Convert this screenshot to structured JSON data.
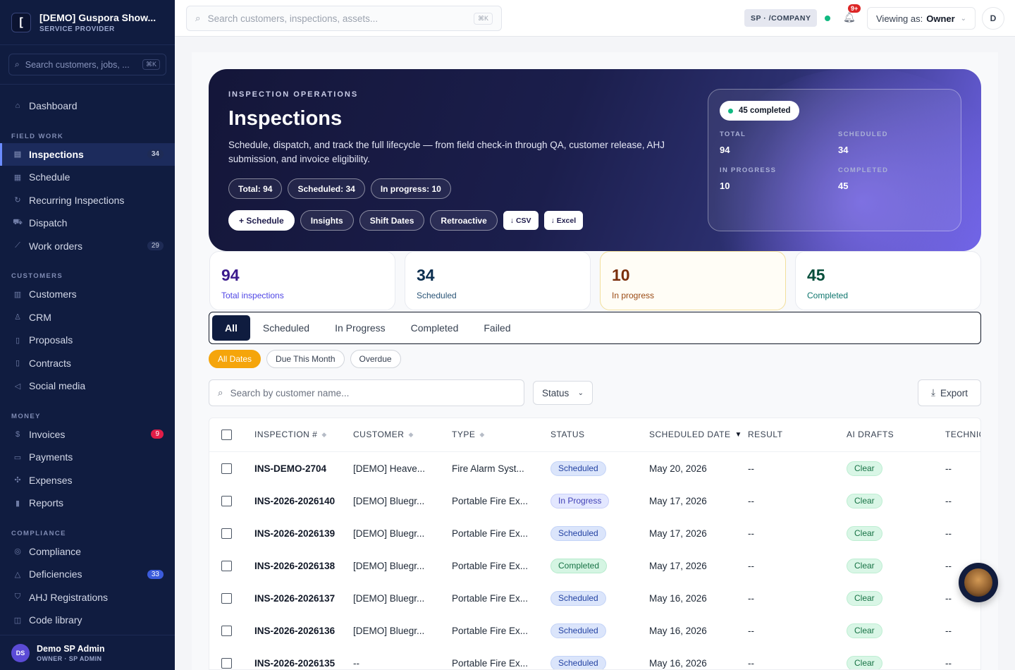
{
  "brand": {
    "logo": "[",
    "title": "[DEMO] Guspora Show...",
    "subtitle": "SERVICE PROVIDER"
  },
  "sidebar": {
    "search_placeholder": "Search customers, jobs, ...",
    "search_kbd": "⌘K",
    "dashboard": "Dashboard",
    "groups": {
      "field_work": "FIELD WORK",
      "customers": "CUSTOMERS",
      "money": "MONEY",
      "compliance": "COMPLIANCE"
    },
    "items": {
      "inspections": {
        "label": "Inspections",
        "badge": "34"
      },
      "schedule": {
        "label": "Schedule"
      },
      "recurring": {
        "label": "Recurring Inspections"
      },
      "dispatch": {
        "label": "Dispatch"
      },
      "work_orders": {
        "label": "Work orders",
        "badge": "29"
      },
      "customers": {
        "label": "Customers"
      },
      "crm": {
        "label": "CRM"
      },
      "proposals": {
        "label": "Proposals"
      },
      "contracts": {
        "label": "Contracts"
      },
      "social": {
        "label": "Social media"
      },
      "invoices": {
        "label": "Invoices",
        "badge": "9"
      },
      "payments": {
        "label": "Payments"
      },
      "expenses": {
        "label": "Expenses"
      },
      "reports": {
        "label": "Reports"
      },
      "compliance": {
        "label": "Compliance"
      },
      "deficiencies": {
        "label": "Deficiencies",
        "badge": "33"
      },
      "ahj": {
        "label": "AHJ Registrations"
      },
      "code_library": {
        "label": "Code library"
      }
    },
    "user": {
      "initials": "DS",
      "name": "Demo SP Admin",
      "role": "OWNER · SP ADMIN"
    }
  },
  "topbar": {
    "search_placeholder": "Search customers, inspections, assets...",
    "search_kbd": "⌘K",
    "company_badge": "SP · /COMPANY",
    "notifications": "9+",
    "viewing_label": "Viewing as:",
    "viewing_value": "Owner",
    "user_initial": "D"
  },
  "hero": {
    "eyebrow": "INSPECTION OPERATIONS",
    "title": "Inspections",
    "description": "Schedule, dispatch, and track the full lifecycle — from field check-in through QA, customer release, AHJ submission, and invoice eligibility.",
    "pills": [
      "Total: 94",
      "Scheduled: 34",
      "In progress: 10"
    ],
    "actions": {
      "schedule": "+ Schedule",
      "insights": "Insights",
      "shift_dates": "Shift Dates",
      "retroactive": "Retroactive",
      "csv": "↓ CSV",
      "excel": "↓ Excel"
    },
    "summary": {
      "completed_pill": "45 completed",
      "total_label": "TOTAL",
      "total": "94",
      "scheduled_label": "SCHEDULED",
      "scheduled": "34",
      "in_progress_label": "IN PROGRESS",
      "in_progress": "10",
      "completed_label": "COMPLETED",
      "completed": "45"
    }
  },
  "kpis": [
    {
      "value": "94",
      "label": "Total inspections"
    },
    {
      "value": "34",
      "label": "Scheduled"
    },
    {
      "value": "10",
      "label": "In progress"
    },
    {
      "value": "45",
      "label": "Completed"
    }
  ],
  "tabs": [
    "All",
    "Scheduled",
    "In Progress",
    "Completed",
    "Failed"
  ],
  "date_filters": [
    "All Dates",
    "Due This Month",
    "Overdue"
  ],
  "filters": {
    "search_placeholder": "Search by customer name...",
    "status_label": "Status",
    "export_label": "Export"
  },
  "table": {
    "headers": {
      "inspection": "INSPECTION #",
      "customer": "CUSTOMER",
      "type": "TYPE",
      "status": "STATUS",
      "scheduled_date": "SCHEDULED DATE",
      "result": "RESULT",
      "ai_drafts": "AI DRAFTS",
      "technician": "TECHNIC"
    },
    "rows": [
      {
        "id": "INS-DEMO-2704",
        "customer": "[DEMO] Heave...",
        "type": "Fire Alarm Syst...",
        "status": "Scheduled",
        "date": "May 20, 2026",
        "result": "--",
        "ai": "Clear",
        "tech": "--"
      },
      {
        "id": "INS-2026-2026140",
        "customer": "[DEMO] Bluegr...",
        "type": "Portable Fire Ex...",
        "status": "In Progress",
        "date": "May 17, 2026",
        "result": "--",
        "ai": "Clear",
        "tech": "--"
      },
      {
        "id": "INS-2026-2026139",
        "customer": "[DEMO] Bluegr...",
        "type": "Portable Fire Ex...",
        "status": "Scheduled",
        "date": "May 17, 2026",
        "result": "--",
        "ai": "Clear",
        "tech": "--"
      },
      {
        "id": "INS-2026-2026138",
        "customer": "[DEMO] Bluegr...",
        "type": "Portable Fire Ex...",
        "status": "Completed",
        "date": "May 17, 2026",
        "result": "--",
        "ai": "Clear",
        "tech": "--"
      },
      {
        "id": "INS-2026-2026137",
        "customer": "[DEMO] Bluegr...",
        "type": "Portable Fire Ex...",
        "status": "Scheduled",
        "date": "May 16, 2026",
        "result": "--",
        "ai": "Clear",
        "tech": "--"
      },
      {
        "id": "INS-2026-2026136",
        "customer": "[DEMO] Bluegr...",
        "type": "Portable Fire Ex...",
        "status": "Scheduled",
        "date": "May 16, 2026",
        "result": "--",
        "ai": "Clear",
        "tech": "--"
      },
      {
        "id": "INS-2026-2026135",
        "customer": "--",
        "type": "Portable Fire Ex...",
        "status": "Scheduled",
        "date": "May 16, 2026",
        "result": "--",
        "ai": "Clear",
        "tech": "--"
      }
    ]
  },
  "colors": {
    "sidebar": "#101c40",
    "accent": "#6b8cff",
    "amber": "#f5a50b",
    "success": "#10b981"
  }
}
